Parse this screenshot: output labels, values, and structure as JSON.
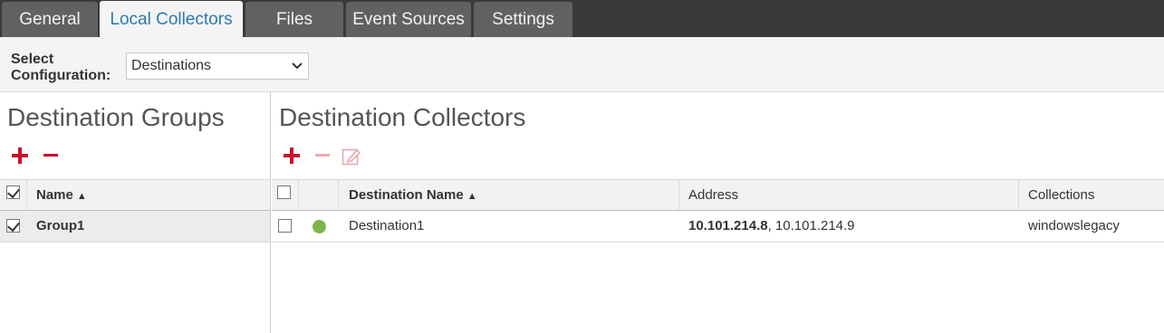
{
  "tabs": [
    {
      "label": "General",
      "active": false
    },
    {
      "label": "Local Collectors",
      "active": true
    },
    {
      "label": "Files",
      "active": false
    },
    {
      "label": "Event Sources",
      "active": false
    },
    {
      "label": "Settings",
      "active": false
    }
  ],
  "config": {
    "label_line1": "Select",
    "label_line2": "Configuration:",
    "selected": "Destinations"
  },
  "groups_panel": {
    "title": "Destination Groups",
    "add_icon": "plus-icon",
    "remove_icon": "minus-icon",
    "header": {
      "name": "Name",
      "sort": "▲"
    },
    "rows": [
      {
        "name": "Group1",
        "checked": true
      }
    ]
  },
  "collectors_panel": {
    "title": "Destination Collectors",
    "add_icon": "plus-icon",
    "remove_icon": "minus-icon",
    "edit_icon": "edit-icon",
    "header": {
      "destination_name": "Destination Name",
      "sort": "▲",
      "address": "Address",
      "collections": "Collections"
    },
    "rows": [
      {
        "name": "Destination1",
        "status": "online",
        "address_primary": "10.101.214.8",
        "address_rest": ", 10.101.214.9",
        "collections": "windowslegacy"
      }
    ]
  },
  "colors": {
    "accent": "#2a7ab0",
    "danger": "#c8102e",
    "status_online": "#7ab648",
    "tabbar": "#3a3a3a"
  }
}
